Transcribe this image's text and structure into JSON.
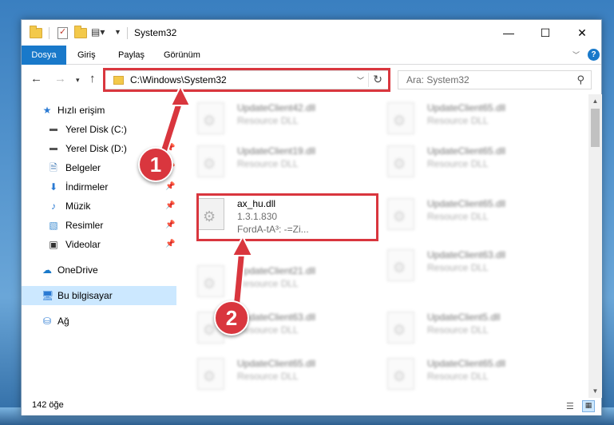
{
  "window": {
    "title": "System32",
    "minimize_glyph": "—",
    "maximize_glyph": "☐",
    "close_glyph": "✕"
  },
  "ribbon": {
    "tabs": [
      "Dosya",
      "Giriş",
      "Paylaş",
      "Görünüm"
    ],
    "help_glyph": "?"
  },
  "nav": {
    "address": "C:\\Windows\\System32",
    "search_placeholder": "Ara: System32"
  },
  "sidebar": {
    "items": [
      {
        "label": "Hızlı erişim",
        "icon": "star-icon"
      },
      {
        "label": "Yerel Disk (C:)",
        "icon": "drive-icon"
      },
      {
        "label": "Yerel Disk (D:)",
        "icon": "drive-icon"
      },
      {
        "label": "Belgeler",
        "icon": "document-icon"
      },
      {
        "label": "İndirmeler",
        "icon": "download-icon"
      },
      {
        "label": "Müzik",
        "icon": "music-icon"
      },
      {
        "label": "Resimler",
        "icon": "picture-icon"
      },
      {
        "label": "Videolar",
        "icon": "video-icon"
      },
      {
        "label": "OneDrive",
        "icon": "cloud-icon"
      },
      {
        "label": "Bu bilgisayar",
        "icon": "computer-icon"
      },
      {
        "label": "Ağ",
        "icon": "network-icon"
      }
    ]
  },
  "files": {
    "left_column": [
      {
        "name": "UpdateClient42.dll",
        "sub": "Resource DLL"
      },
      {
        "name": "UpdateClient19.dll",
        "sub": "Resource DLL"
      },
      {
        "name": "UpdateClient21.dll",
        "sub": "Resource DLL"
      },
      {
        "name": "UpdateClient63.dll",
        "sub": "Resource DLL"
      },
      {
        "name": "UpdateClient65.dll",
        "sub": "Resource DLL"
      }
    ],
    "right_column": [
      {
        "name": "UpdateClient65.dll",
        "sub": "Resource DLL"
      },
      {
        "name": "UpdateClient65.dll",
        "sub": "Resource DLL"
      },
      {
        "name": "UpdateClient65.dll",
        "sub": "Resource DLL"
      },
      {
        "name": "UpdateClient63.dll",
        "sub": "Resource DLL"
      },
      {
        "name": "UpdateClient5.dll",
        "sub": "Resource DLL"
      },
      {
        "name": "UpdateClient65.dll",
        "sub": "Resource DLL"
      }
    ],
    "highlighted": {
      "name": "ax_hu.dll",
      "version": "1.3.1.830",
      "description": "FordA-tA³: -=Zi..."
    }
  },
  "status": {
    "item_count": "142 öğe"
  },
  "callouts": {
    "one": "1",
    "two": "2"
  },
  "colors": {
    "accent": "#1979ca",
    "highlight_red": "#d9363e",
    "selection": "#cce8ff"
  }
}
